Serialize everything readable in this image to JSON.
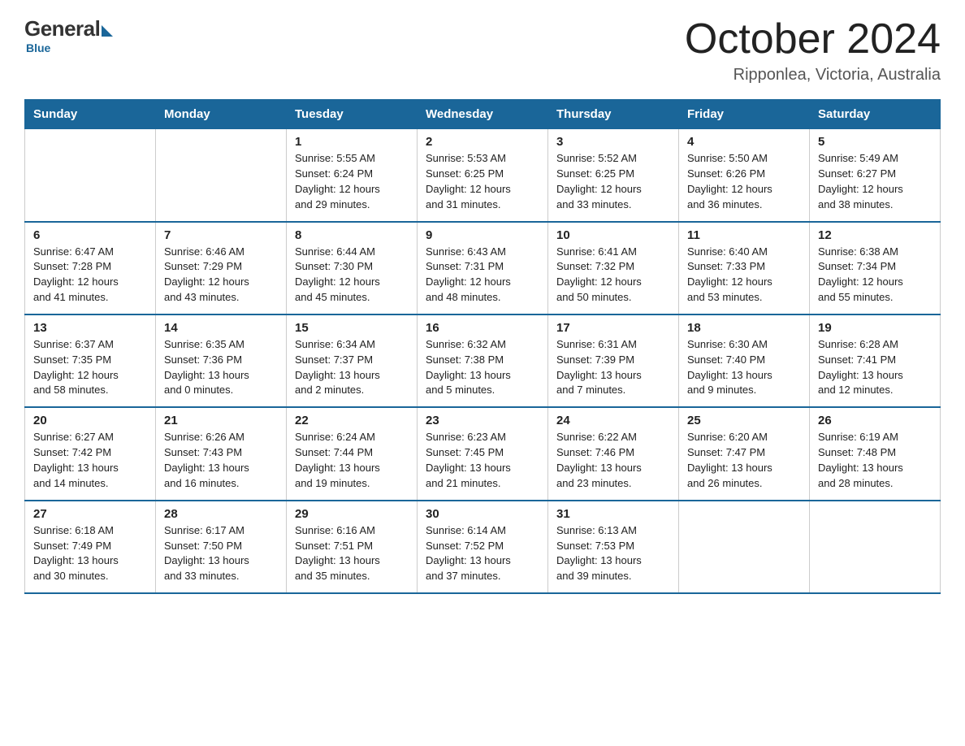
{
  "header": {
    "logo": {
      "general": "General",
      "blue": "Blue"
    },
    "title": "October 2024",
    "location": "Ripponlea, Victoria, Australia"
  },
  "days_of_week": [
    "Sunday",
    "Monday",
    "Tuesday",
    "Wednesday",
    "Thursday",
    "Friday",
    "Saturday"
  ],
  "weeks": [
    [
      {
        "day": "",
        "info": ""
      },
      {
        "day": "",
        "info": ""
      },
      {
        "day": "1",
        "info": "Sunrise: 5:55 AM\nSunset: 6:24 PM\nDaylight: 12 hours\nand 29 minutes."
      },
      {
        "day": "2",
        "info": "Sunrise: 5:53 AM\nSunset: 6:25 PM\nDaylight: 12 hours\nand 31 minutes."
      },
      {
        "day": "3",
        "info": "Sunrise: 5:52 AM\nSunset: 6:25 PM\nDaylight: 12 hours\nand 33 minutes."
      },
      {
        "day": "4",
        "info": "Sunrise: 5:50 AM\nSunset: 6:26 PM\nDaylight: 12 hours\nand 36 minutes."
      },
      {
        "day": "5",
        "info": "Sunrise: 5:49 AM\nSunset: 6:27 PM\nDaylight: 12 hours\nand 38 minutes."
      }
    ],
    [
      {
        "day": "6",
        "info": "Sunrise: 6:47 AM\nSunset: 7:28 PM\nDaylight: 12 hours\nand 41 minutes."
      },
      {
        "day": "7",
        "info": "Sunrise: 6:46 AM\nSunset: 7:29 PM\nDaylight: 12 hours\nand 43 minutes."
      },
      {
        "day": "8",
        "info": "Sunrise: 6:44 AM\nSunset: 7:30 PM\nDaylight: 12 hours\nand 45 minutes."
      },
      {
        "day": "9",
        "info": "Sunrise: 6:43 AM\nSunset: 7:31 PM\nDaylight: 12 hours\nand 48 minutes."
      },
      {
        "day": "10",
        "info": "Sunrise: 6:41 AM\nSunset: 7:32 PM\nDaylight: 12 hours\nand 50 minutes."
      },
      {
        "day": "11",
        "info": "Sunrise: 6:40 AM\nSunset: 7:33 PM\nDaylight: 12 hours\nand 53 minutes."
      },
      {
        "day": "12",
        "info": "Sunrise: 6:38 AM\nSunset: 7:34 PM\nDaylight: 12 hours\nand 55 minutes."
      }
    ],
    [
      {
        "day": "13",
        "info": "Sunrise: 6:37 AM\nSunset: 7:35 PM\nDaylight: 12 hours\nand 58 minutes."
      },
      {
        "day": "14",
        "info": "Sunrise: 6:35 AM\nSunset: 7:36 PM\nDaylight: 13 hours\nand 0 minutes."
      },
      {
        "day": "15",
        "info": "Sunrise: 6:34 AM\nSunset: 7:37 PM\nDaylight: 13 hours\nand 2 minutes."
      },
      {
        "day": "16",
        "info": "Sunrise: 6:32 AM\nSunset: 7:38 PM\nDaylight: 13 hours\nand 5 minutes."
      },
      {
        "day": "17",
        "info": "Sunrise: 6:31 AM\nSunset: 7:39 PM\nDaylight: 13 hours\nand 7 minutes."
      },
      {
        "day": "18",
        "info": "Sunrise: 6:30 AM\nSunset: 7:40 PM\nDaylight: 13 hours\nand 9 minutes."
      },
      {
        "day": "19",
        "info": "Sunrise: 6:28 AM\nSunset: 7:41 PM\nDaylight: 13 hours\nand 12 minutes."
      }
    ],
    [
      {
        "day": "20",
        "info": "Sunrise: 6:27 AM\nSunset: 7:42 PM\nDaylight: 13 hours\nand 14 minutes."
      },
      {
        "day": "21",
        "info": "Sunrise: 6:26 AM\nSunset: 7:43 PM\nDaylight: 13 hours\nand 16 minutes."
      },
      {
        "day": "22",
        "info": "Sunrise: 6:24 AM\nSunset: 7:44 PM\nDaylight: 13 hours\nand 19 minutes."
      },
      {
        "day": "23",
        "info": "Sunrise: 6:23 AM\nSunset: 7:45 PM\nDaylight: 13 hours\nand 21 minutes."
      },
      {
        "day": "24",
        "info": "Sunrise: 6:22 AM\nSunset: 7:46 PM\nDaylight: 13 hours\nand 23 minutes."
      },
      {
        "day": "25",
        "info": "Sunrise: 6:20 AM\nSunset: 7:47 PM\nDaylight: 13 hours\nand 26 minutes."
      },
      {
        "day": "26",
        "info": "Sunrise: 6:19 AM\nSunset: 7:48 PM\nDaylight: 13 hours\nand 28 minutes."
      }
    ],
    [
      {
        "day": "27",
        "info": "Sunrise: 6:18 AM\nSunset: 7:49 PM\nDaylight: 13 hours\nand 30 minutes."
      },
      {
        "day": "28",
        "info": "Sunrise: 6:17 AM\nSunset: 7:50 PM\nDaylight: 13 hours\nand 33 minutes."
      },
      {
        "day": "29",
        "info": "Sunrise: 6:16 AM\nSunset: 7:51 PM\nDaylight: 13 hours\nand 35 minutes."
      },
      {
        "day": "30",
        "info": "Sunrise: 6:14 AM\nSunset: 7:52 PM\nDaylight: 13 hours\nand 37 minutes."
      },
      {
        "day": "31",
        "info": "Sunrise: 6:13 AM\nSunset: 7:53 PM\nDaylight: 13 hours\nand 39 minutes."
      },
      {
        "day": "",
        "info": ""
      },
      {
        "day": "",
        "info": ""
      }
    ]
  ]
}
